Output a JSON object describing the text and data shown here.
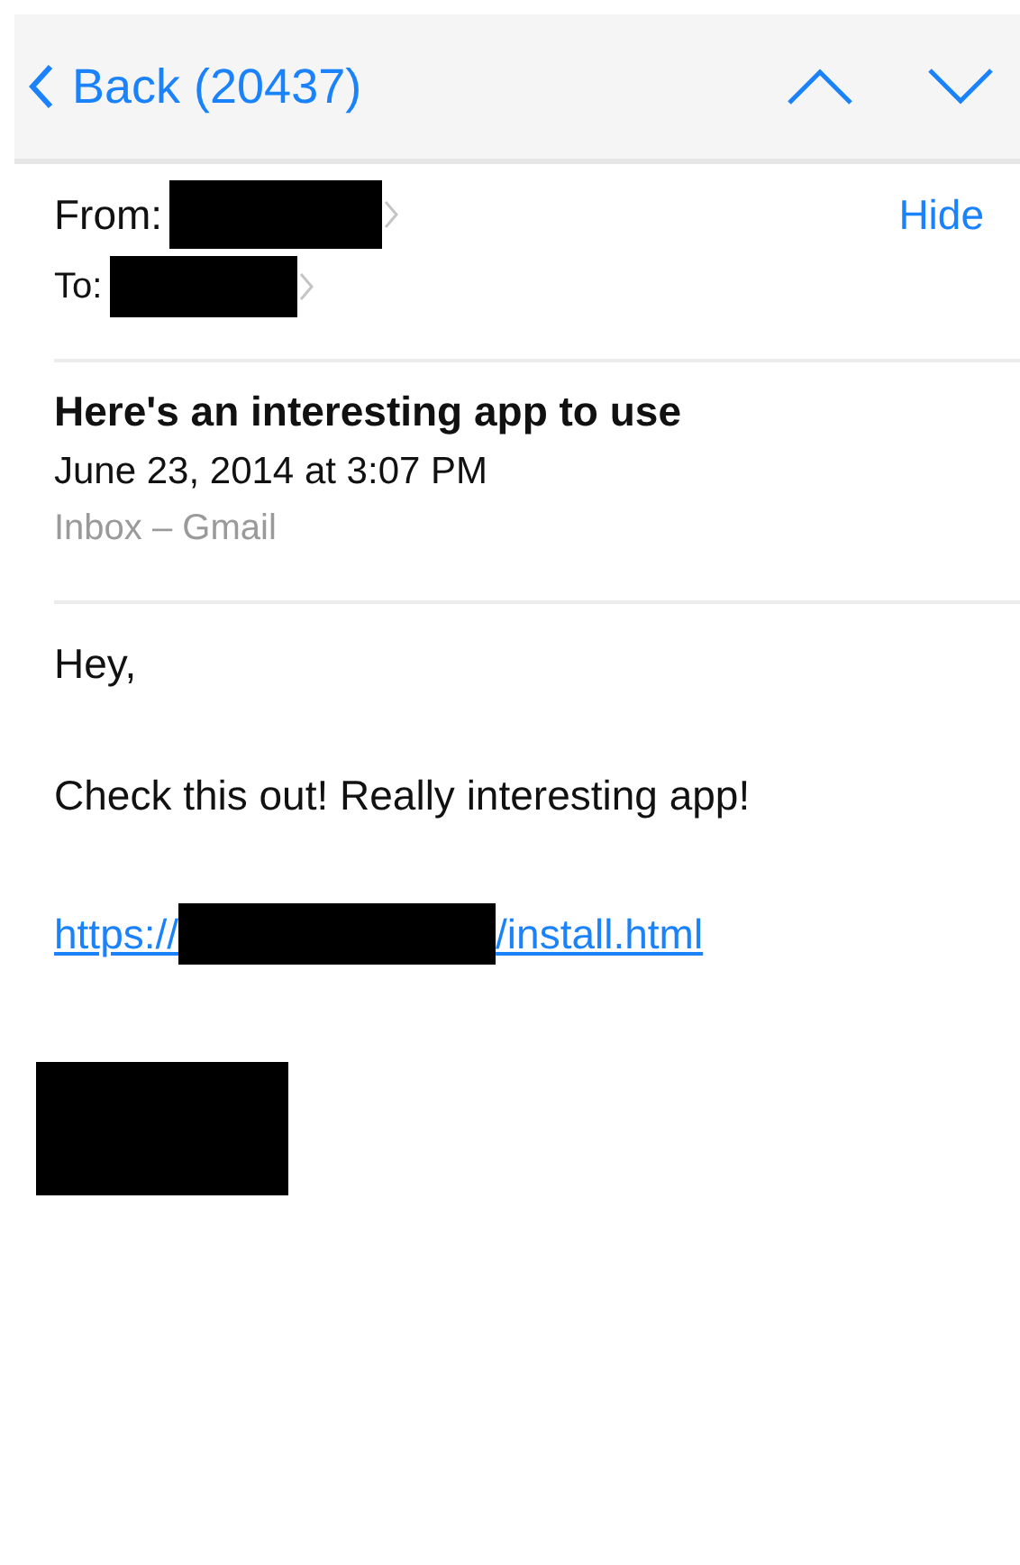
{
  "nav": {
    "back": "Back (20437)"
  },
  "header": {
    "from_label": "From:",
    "to_label": "To:",
    "hide": "Hide"
  },
  "message": {
    "subject": "Here's an interesting app to use",
    "date": "June 23, 2014 at 3:07 PM",
    "mailbox": "Inbox – Gmail"
  },
  "body": {
    "greeting": "Hey,",
    "text": "Check this out! Really interesting app!",
    "link_start": "https://",
    "link_end": "/install.html"
  }
}
